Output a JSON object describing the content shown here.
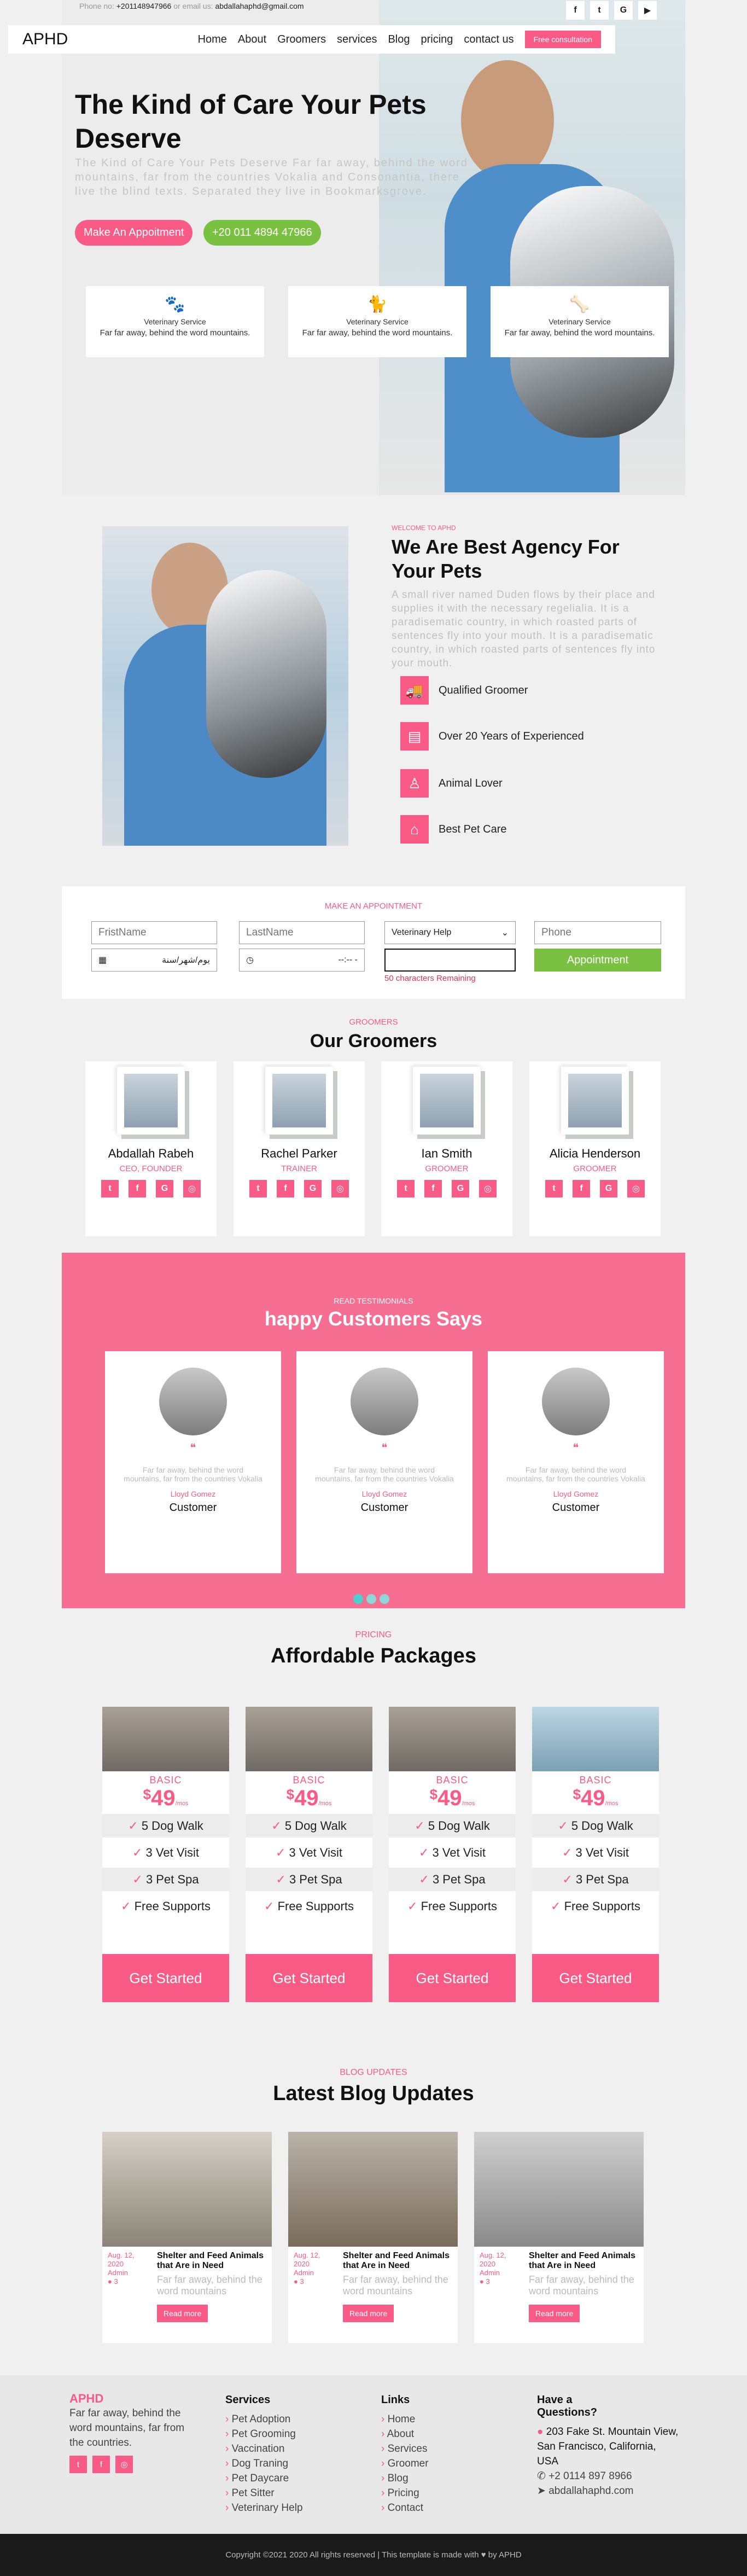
{
  "topbar": {
    "phone_prefix": "Phone no:",
    "phone": "+201148947966",
    "email_prefix": "or email us:",
    "email": "abdallahaphd@gmail.com",
    "social": [
      "f",
      "t",
      "G",
      "▶"
    ]
  },
  "nav": {
    "brand": "APHD",
    "items": [
      "Home",
      "About",
      "Groomers",
      "services",
      "Blog",
      "pricing",
      "contact us"
    ],
    "cta": "Free consultation"
  },
  "hero": {
    "title": "The Kind of Care Your Pets Deserve",
    "subtitle": "The Kind of Care Your Pets Deserve Far far away, behind the word mountains, far from the countries Vokalia and Consonantia, there live the blind texts. Separated they live in Bookmarksgrove.",
    "btn_appointment": "Make An Appoitment",
    "btn_phone": "+20 011 4894 47966",
    "services": [
      {
        "title": "Veterinary Service",
        "text": "Far far away, behind the word mountains."
      },
      {
        "title": "Veterinary Service",
        "text": "Far far away, behind the word mountains."
      },
      {
        "title": "Veterinary Service",
        "text": "Far far away, behind the word mountains."
      }
    ]
  },
  "about": {
    "kicker": "WELCOME TO APHD",
    "title": "We Are Best Agency For Your Pets",
    "text": "A small river named Duden flows by their place and supplies it with the necessary regelialia. It is a paradisematic country, in which roasted parts of sentences fly into your mouth. It is a paradisematic country, in which roasted parts of sentences fly into your mouth.",
    "features": [
      "Qualified Groomer",
      "Over 20 Years of Experienced",
      "Animal Lover",
      "Best Pet Care"
    ]
  },
  "appointment": {
    "heading": "MAKE AN APPOINTMENT",
    "first_placeholder": "FristName",
    "last_placeholder": "LastName",
    "service_selected": "Veterinary Help",
    "phone_placeholder": "Phone",
    "date_value": "يوم/شهر/سنة",
    "time_value": "--:-- -",
    "remaining": "50 characters Remaining",
    "submit": "Appointment"
  },
  "groomers": {
    "kicker": "GROOMERS",
    "title": "Our Groomers",
    "items": [
      {
        "name": "Abdallah Rabeh",
        "role": "CEO, FOUNDER"
      },
      {
        "name": "Rachel Parker",
        "role": "TRAINER"
      },
      {
        "name": "Ian Smith",
        "role": "GROOMER"
      },
      {
        "name": "Alicia Henderson",
        "role": "GROOMER"
      }
    ],
    "social": [
      "t",
      "f",
      "G",
      "◎"
    ]
  },
  "testimonials": {
    "kicker": "READ TESTIMONIALS",
    "title": "happy Customers Says",
    "quote_mark": "❝",
    "items": [
      {
        "text": "Far far away, behind the word mountains, far from the countries Vokalia",
        "name": "Lloyd Gomez",
        "role": "Customer"
      },
      {
        "text": "Far far away, behind the word mountains, far from the countries Vokalia",
        "name": "Lloyd Gomez",
        "role": "Customer"
      },
      {
        "text": "Far far away, behind the word mountains, far from the countries Vokalia",
        "name": "Lloyd Gomez",
        "role": "Customer"
      }
    ]
  },
  "pricing": {
    "kicker": "PRICING",
    "title": "Affordable Packages",
    "plans": [
      {
        "name": "BASIC",
        "currency": "$",
        "price": "49",
        "per": "/mos"
      },
      {
        "name": "BASIC",
        "currency": "$",
        "price": "49",
        "per": "/mos"
      },
      {
        "name": "BASIC",
        "currency": "$",
        "price": "49",
        "per": "/mos"
      },
      {
        "name": "BASIC",
        "currency": "$",
        "price": "49",
        "per": "/mos"
      }
    ],
    "features": [
      "5 Dog Walk",
      "3 Vet Visit",
      "3 Pet Spa",
      "Free Supports"
    ],
    "button": "Get Started"
  },
  "blog": {
    "kicker": "BLOG UPDATES",
    "title": "Latest Blog Updates",
    "posts": [
      {
        "date": "Aug. 12, 2020",
        "author": "Admin",
        "comments": "3",
        "title": "Shelter and Feed Animals that Are in Need",
        "text": "Far far away, behind the word mountains",
        "button": "Read more"
      },
      {
        "date": "Aug. 12, 2020",
        "author": "Admin",
        "comments": "3",
        "title": "Shelter and Feed Animals that Are in Need",
        "text": "Far far away, behind the word mountains",
        "button": "Read more"
      },
      {
        "date": "Aug. 12, 2020",
        "author": "Admin",
        "comments": "3",
        "title": "Shelter and Feed Animals that Are in Need",
        "text": "Far far away, behind the word mountains",
        "button": "Read more"
      }
    ]
  },
  "footer": {
    "brand": "APHD",
    "about": "Far far away, behind the word mountains, far from the countries.",
    "services_title": "Services",
    "services": [
      "Pet Adoption",
      "Pet Grooming",
      "Vaccination",
      "Dog Traning",
      "Pet Daycare",
      "Pet Sitter",
      "Veterinary Help"
    ],
    "links_title": "Links",
    "links": [
      "Home",
      "About",
      "Services",
      "Groomer",
      "Blog",
      "Pricing",
      "Contact"
    ],
    "questions_title": "Have a Questions?",
    "address": "203 Fake St. Mountain View, San Francisco, California, USA",
    "phone": "+2 0114 897 8966",
    "email": "abdallahaphd.com",
    "copyright": "Copyright ©2021 2020 All rights reserved | This template is made with ♥ by APHD"
  }
}
